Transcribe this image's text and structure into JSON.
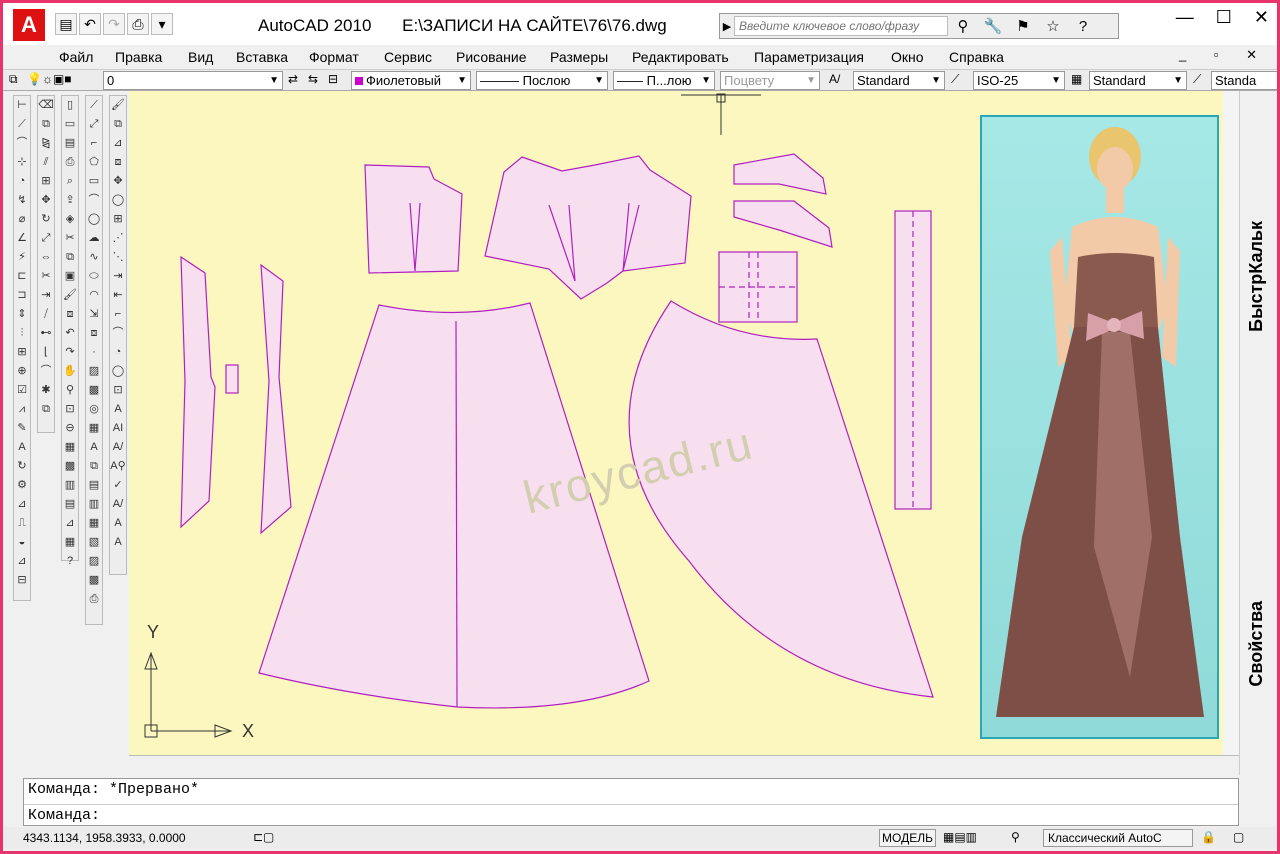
{
  "titlebar": {
    "app_logo": "A",
    "app_name": "AutoCAD 2010",
    "file_path": "E:\\ЗАПИСИ НА САЙТЕ\\76\\76.dwg",
    "search_placeholder": "Введите ключевое слово/фразу",
    "qat_icons": [
      "save-icon",
      "undo-icon",
      "redo-icon",
      "plot-icon",
      "dropdown-icon"
    ],
    "window_controls": {
      "minimize": "—",
      "maximize": "☐",
      "close": "✕"
    }
  },
  "menu": {
    "items": [
      "Файл",
      "Правка",
      "Вид",
      "Вставка",
      "Формат",
      "Сервис",
      "Рисование",
      "Размеры",
      "Редактировать",
      "Параметризация",
      "Окно",
      "Справка"
    ],
    "mdi_controls": "_ ▫ ✕"
  },
  "properties": {
    "layer": "0",
    "color": "Фиолетовый",
    "color_hex": "#c000c0",
    "linetype": "——— Послою",
    "lineweight": "—— П...лою",
    "plotstyle": "Поцвету",
    "text_style": "Standard",
    "dim_style": "ISO-25",
    "table_style": "Standard",
    "multileader_style": "Standa"
  },
  "canvas": {
    "background": "#fbf7bf",
    "pattern_fill": "#f8dff0",
    "pattern_stroke": "#b020c0",
    "watermark": "kroycad.ru",
    "ucs_x": "X",
    "ucs_y": "Y"
  },
  "right_panel": {
    "quickcalc": "БыстрКальк",
    "properties": "Свойства"
  },
  "command": {
    "line1": "Команда: *Прервано*",
    "line2": "Команда:"
  },
  "status": {
    "coords": "4343.1134, 1958.3933, 0.0000",
    "model": "МОДЕЛЬ",
    "workspace": "Классический AutoC"
  }
}
